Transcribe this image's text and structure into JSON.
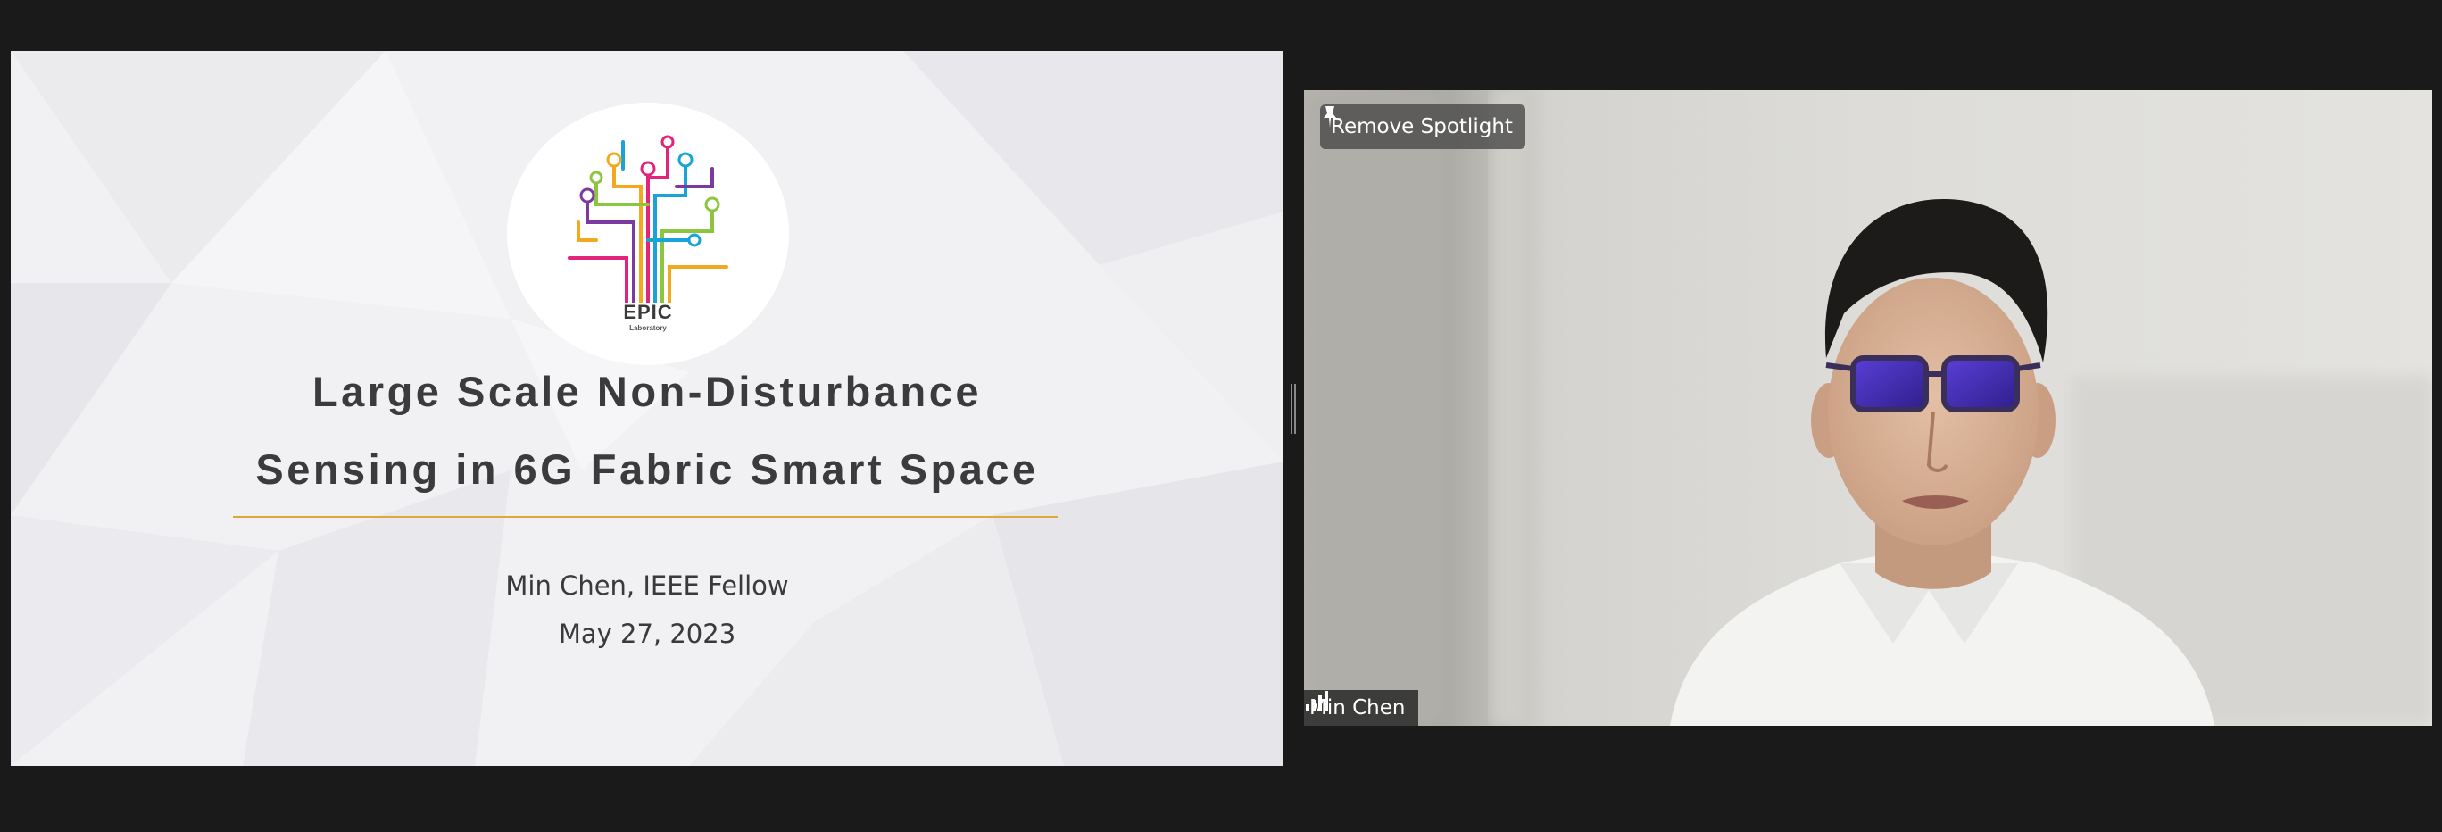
{
  "slide": {
    "logo_title": "EPIC",
    "logo_subtitle": "Laboratory",
    "title_line1": "Large Scale Non-Disturbance",
    "title_line2": "Sensing in 6G Fabric Smart Space",
    "author": "Min Chen, IEEE Fellow",
    "date": "May 27, 2023",
    "accent_rule_color": "#dcaa36"
  },
  "video": {
    "spotlight_label": "Remove Spotlight",
    "spotlight_icon": "pin-icon",
    "participant_name": "Min Chen",
    "signal_icon": "signal-bars-icon"
  },
  "colors": {
    "background": "#1a1a1a",
    "overlay": "#464646"
  }
}
